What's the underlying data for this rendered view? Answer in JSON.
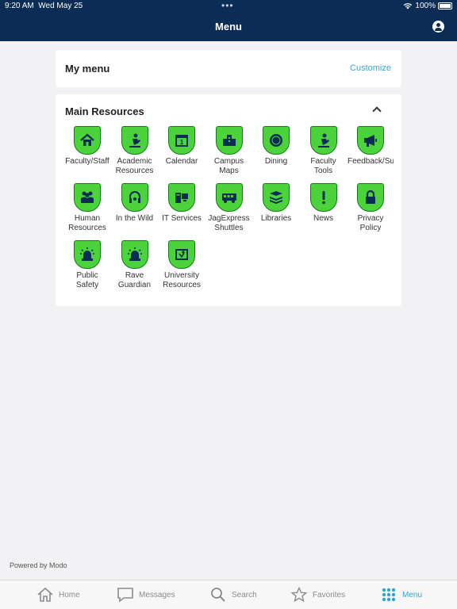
{
  "status_bar": {
    "time": "9:20 AM",
    "date": "Wed May 25",
    "battery": "100%"
  },
  "header": {
    "title": "Menu"
  },
  "my_menu": {
    "title": "My menu",
    "customize_label": "Customize"
  },
  "main_resources": {
    "title": "Main Resources",
    "items": [
      {
        "label": "Faculty/Staff",
        "icon": "house-icon"
      },
      {
        "label": "Academic\nResources",
        "icon": "reading-person-icon"
      },
      {
        "label": "Calendar",
        "icon": "calendar-icon"
      },
      {
        "label": "Campus\nMaps",
        "icon": "buildings-icon"
      },
      {
        "label": "Dining",
        "icon": "plate-icon"
      },
      {
        "label": "Faculty\nTools",
        "icon": "reading-person-icon"
      },
      {
        "label": "Feedback/Su",
        "icon": "megaphone-icon"
      },
      {
        "label": "Human\nResources",
        "icon": "people-icon"
      },
      {
        "label": "In the Wild",
        "icon": "headphones-icon"
      },
      {
        "label": "IT Services",
        "icon": "computer-icon"
      },
      {
        "label": "JagExpress\nShuttles",
        "icon": "bus-icon"
      },
      {
        "label": "Libraries",
        "icon": "books-icon"
      },
      {
        "label": "News",
        "icon": "exclamation-icon"
      },
      {
        "label": "Privacy\nPolicy",
        "icon": "lock-icon"
      },
      {
        "label": "Public\nSafety",
        "icon": "siren-icon"
      },
      {
        "label": "Rave\nGuardian",
        "icon": "siren-icon"
      },
      {
        "label": "University\nResources",
        "icon": "map-pin-icon"
      }
    ]
  },
  "footer": {
    "powered_by": "Powered by Modo"
  },
  "tab_bar": {
    "tabs": [
      {
        "label": "Home",
        "icon": "home-icon"
      },
      {
        "label": "Messages",
        "icon": "chat-bubble-icon"
      },
      {
        "label": "Search",
        "icon": "search-icon"
      },
      {
        "label": "Favorites",
        "icon": "star-icon"
      },
      {
        "label": "Menu",
        "icon": "grid-icon",
        "active": true
      }
    ]
  },
  "colors": {
    "header_bg": "#0b2d55",
    "tile_green": "#4cd33c",
    "icon_navy": "#0b2d55",
    "accent": "#2fa6c8"
  }
}
